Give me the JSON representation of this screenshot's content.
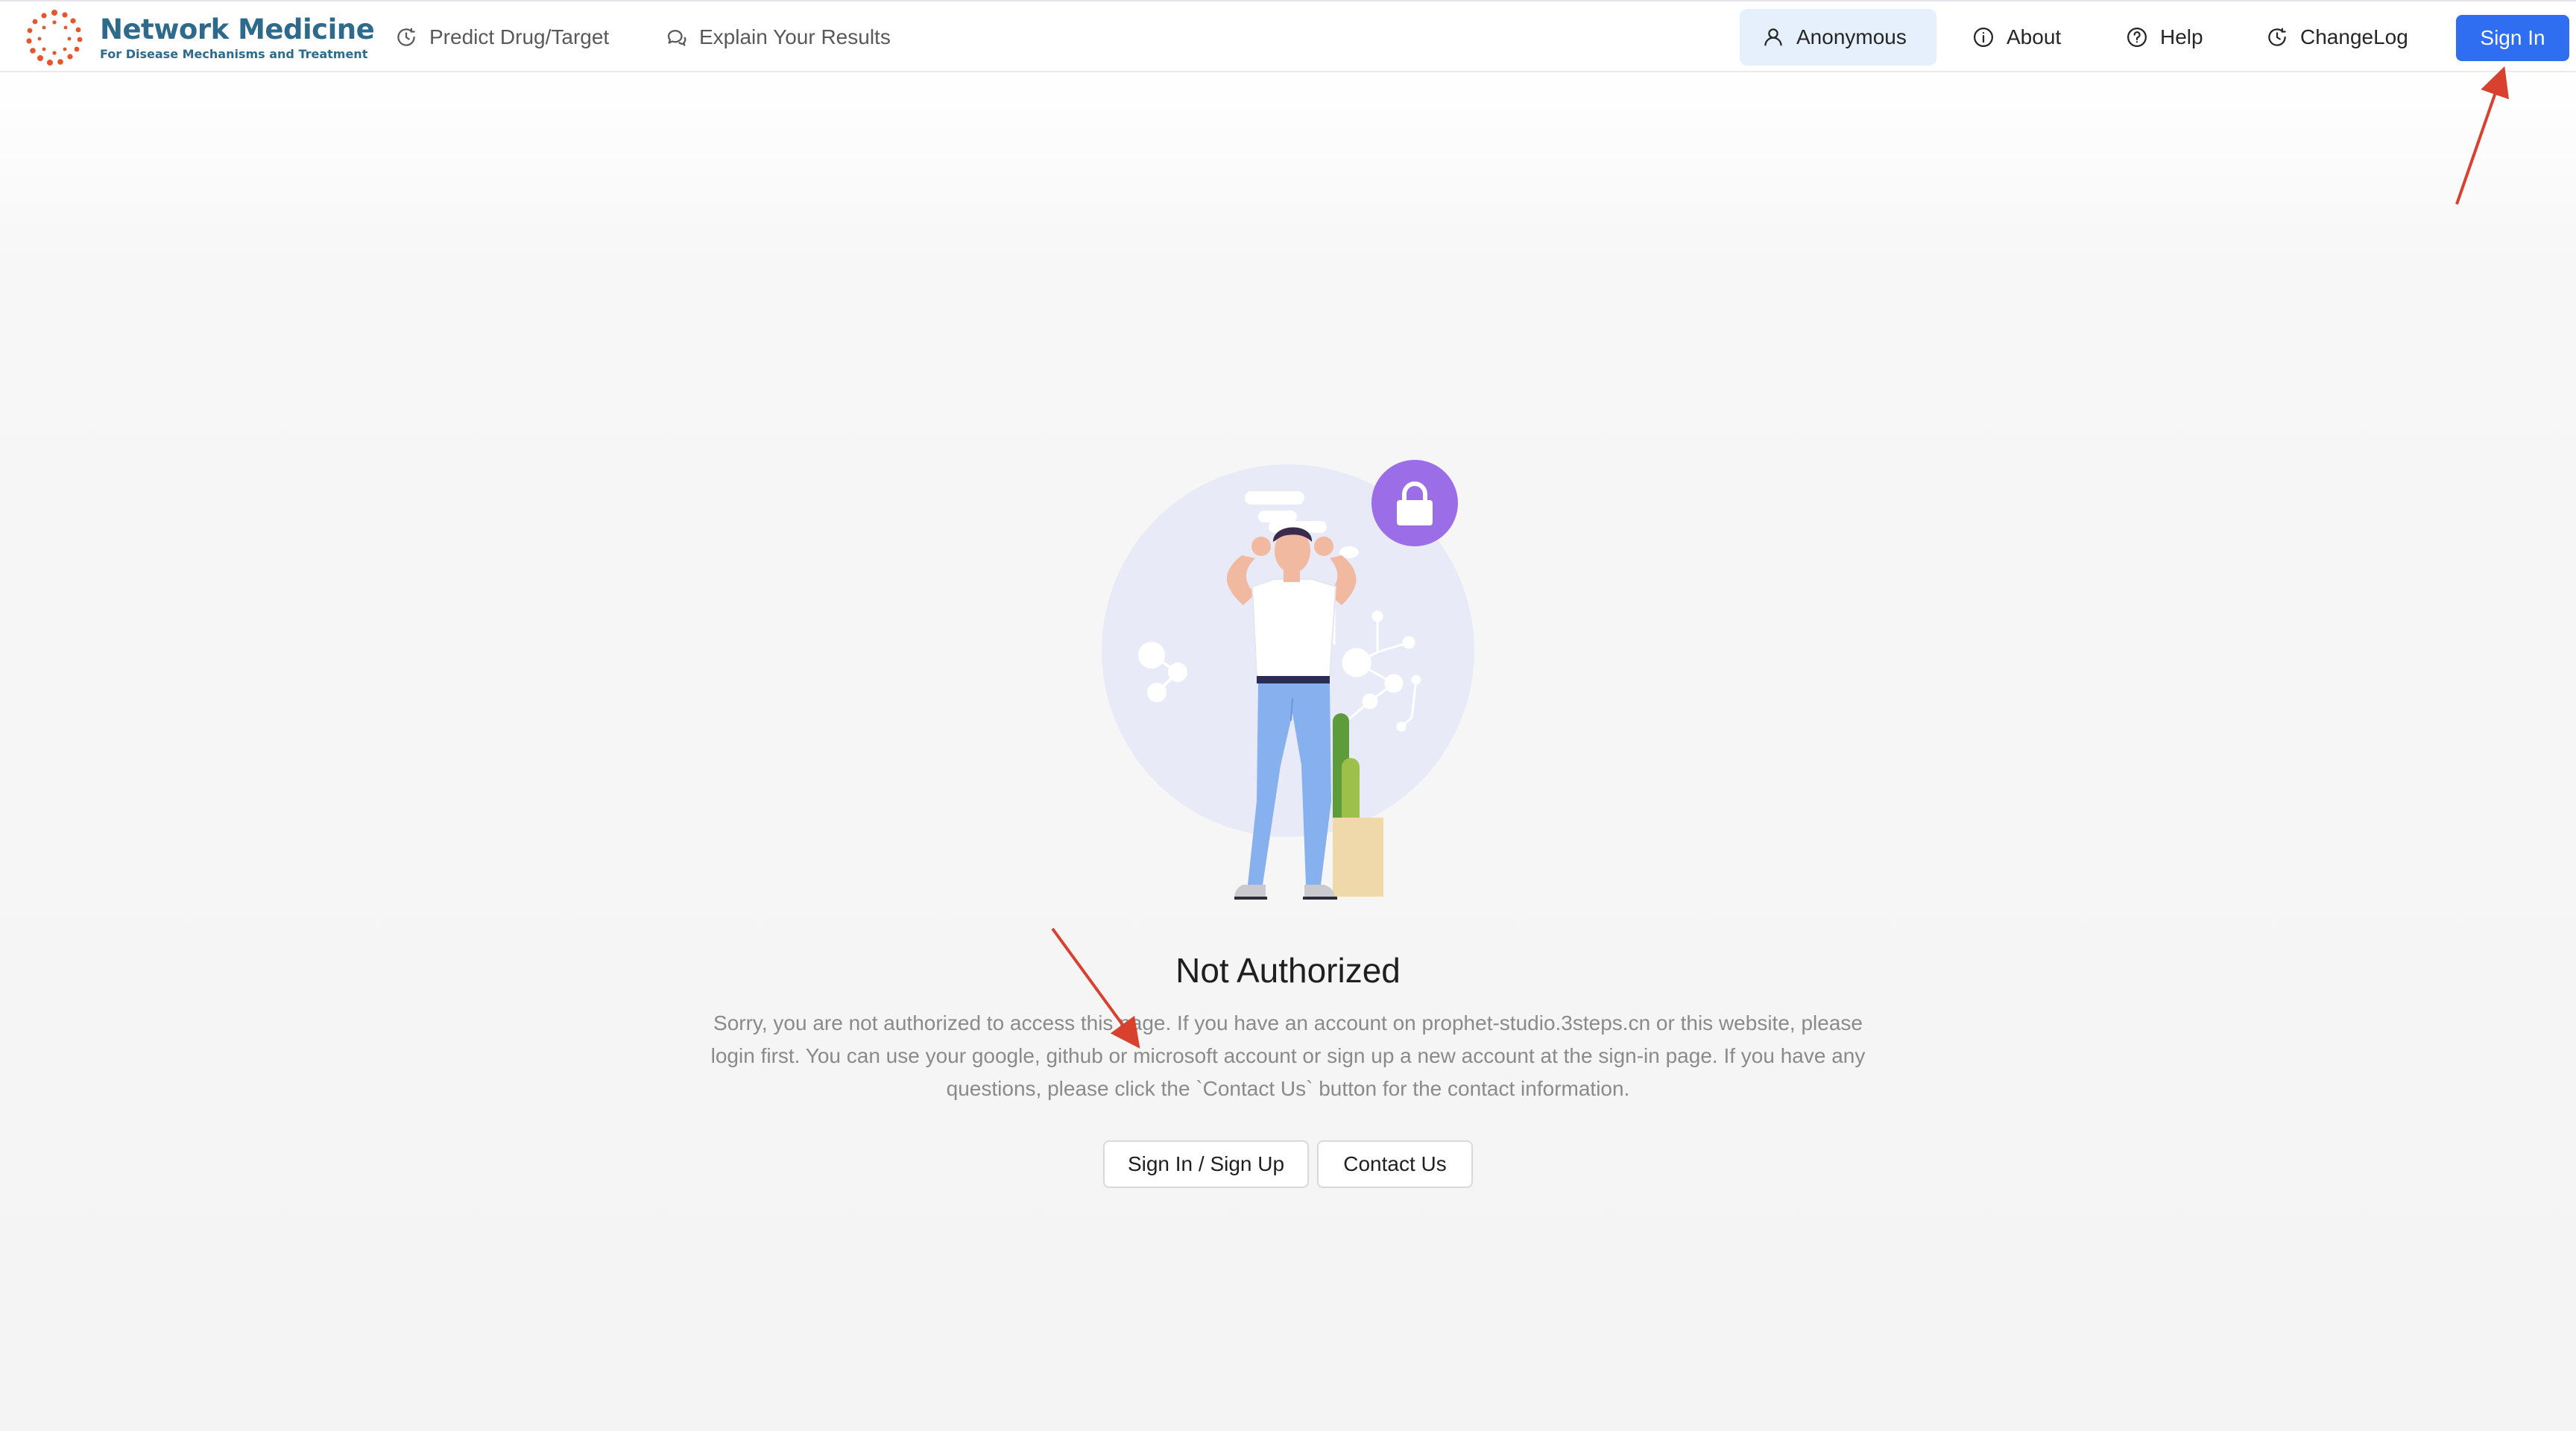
{
  "header": {
    "brand_title": "Network Medicine",
    "brand_subtitle": "For Disease Mechanisms and Treatment",
    "nav_left": [
      {
        "label": "Predict Drug/Target",
        "icon": "clock-icon"
      },
      {
        "label": "Explain Your Results",
        "icon": "chat-icon"
      }
    ],
    "nav_right": [
      {
        "label": "Anonymous",
        "icon": "user-icon"
      },
      {
        "label": "About",
        "icon": "info-icon"
      },
      {
        "label": "Help",
        "icon": "question-icon"
      },
      {
        "label": "ChangeLog",
        "icon": "changelog-icon"
      }
    ],
    "signin_label": "Sign In"
  },
  "main": {
    "title": "Not Authorized",
    "description": "Sorry, you are not authorized to access this page. If you have an account on prophet-studio.3steps.cn or this website, please login first. You can use your google, github or microsoft account or sign up a new account at the sign-in page. If you have any questions, please click the `Contact Us` button for the contact information.",
    "buttons": {
      "signin_signup": "Sign In / Sign Up",
      "contact": "Contact Us"
    }
  },
  "colors": {
    "brand": "#2e6a8c",
    "logo_dots": "#e8552d",
    "primary_button": "#2f6ef0",
    "active_nav_bg": "#e6f0fc",
    "lock_badge": "#9b6ee8",
    "annotation_arrow": "#d9412f"
  }
}
